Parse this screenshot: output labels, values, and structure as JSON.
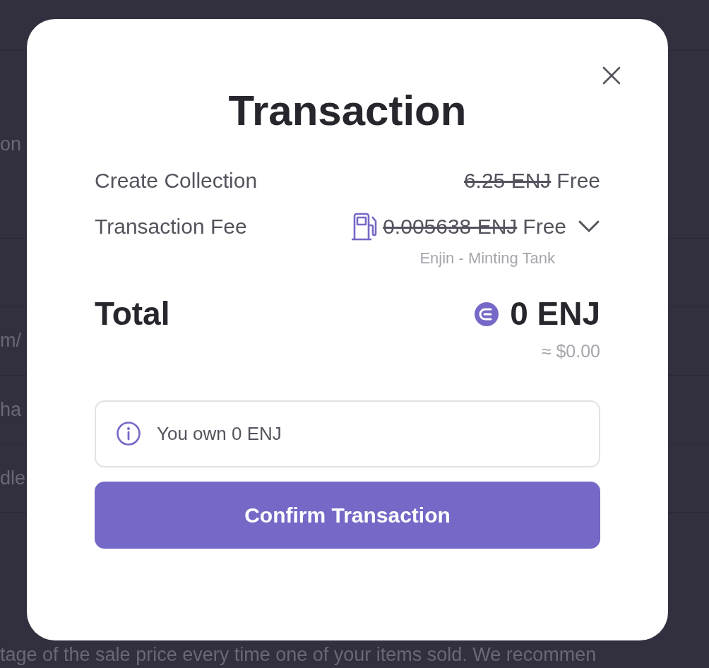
{
  "background": {
    "fragments": [
      "on",
      "m/",
      "ha",
      "dle"
    ],
    "footer_text": "tage of the sale price every time one of your items sold. We recommen"
  },
  "modal": {
    "title": "Transaction",
    "lines": [
      {
        "kind": "plain",
        "label": "Create Collection",
        "original_price": "6.25 ENJ",
        "price": "Free"
      },
      {
        "kind": "fee",
        "label": "Transaction Fee",
        "original_price": "0.005638 ENJ",
        "price": "Free",
        "source": "Enjin - Minting Tank",
        "expanded": false
      }
    ],
    "total": {
      "label": "Total",
      "amount": "0 ENJ",
      "fiat": "≈ $0.00"
    },
    "balance_notice": "You own 0 ENJ",
    "confirm_button": "Confirm Transaction"
  }
}
